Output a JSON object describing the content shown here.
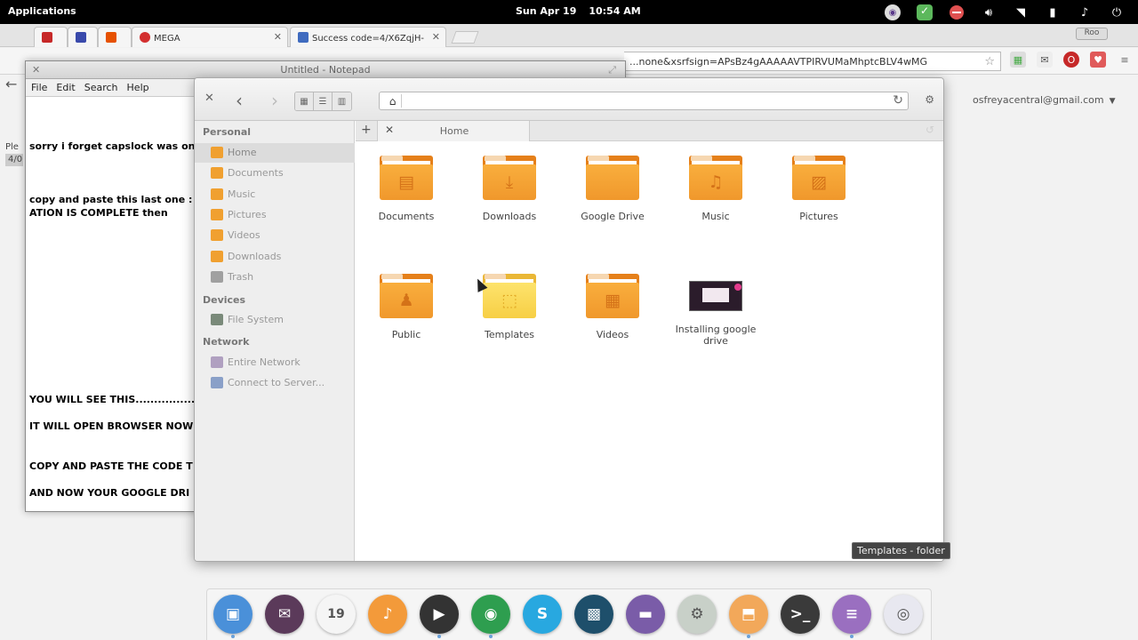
{
  "panel": {
    "applications_label": "Applications",
    "date": "Sun Apr 19",
    "time": "10:54 AM",
    "tray_icons": [
      "screenshot-icon",
      "checkmark-icon",
      "no-entry-icon",
      "volume-icon",
      "wifi-icon",
      "battery-icon",
      "bell-icon",
      "power-icon"
    ]
  },
  "browser": {
    "tabs": [
      {
        "label": "",
        "icon": "gmail-icon",
        "color": "#c62828"
      },
      {
        "label": "",
        "icon": "z-icon",
        "color": "#3949ab"
      },
      {
        "label": "",
        "icon": "tool-icon",
        "color": "#e65100"
      },
      {
        "label": "MEGA",
        "icon": "mega-icon",
        "color": "#d32f2f"
      },
      {
        "label": "Success code=4/X6ZqjH-",
        "icon": "google-icon",
        "color": "#3f6bbf"
      }
    ],
    "url_text": "...none&xsrfsign=APsBz4gAAAAAVTPIRVUMaMhptcBLV4wMG",
    "account": "osfreyacentral@gmail.com",
    "left_stub": [
      "Ple",
      "4/0"
    ],
    "window_button": "Roo"
  },
  "notepad": {
    "title": "Untitled - Notepad",
    "menu": [
      "File",
      "Edit",
      "Search",
      "Help"
    ],
    "lines": [
      "sorry i forget capslock was on",
      "copy and paste this last one : i",
      "ATION IS COMPLETE then",
      "YOU WILL SEE THIS................",
      "IT WILL OPEN BROWSER NOW",
      "COPY AND PASTE THE CODE T",
      "AND NOW YOUR GOOGLE DRI"
    ]
  },
  "files": {
    "tab_label": "Home",
    "sidebar": {
      "personal_heading": "Personal",
      "personal": [
        {
          "label": "Home",
          "icon": "home-icon",
          "color": "#f0a030"
        },
        {
          "label": "Documents",
          "icon": "documents-icon",
          "color": "#f0a030"
        },
        {
          "label": "Music",
          "icon": "music-icon",
          "color": "#f0a030"
        },
        {
          "label": "Pictures",
          "icon": "pictures-icon",
          "color": "#f0a030"
        },
        {
          "label": "Videos",
          "icon": "videos-icon",
          "color": "#f0a030"
        },
        {
          "label": "Downloads",
          "icon": "downloads-icon",
          "color": "#f0a030"
        },
        {
          "label": "Trash",
          "icon": "trash-icon",
          "color": "#a0a0a0"
        }
      ],
      "devices_heading": "Devices",
      "devices": [
        {
          "label": "File System",
          "icon": "drive-icon",
          "color": "#7a8a7a"
        }
      ],
      "network_heading": "Network",
      "network": [
        {
          "label": "Entire Network",
          "icon": "network-icon",
          "color": "#b0a0c0"
        },
        {
          "label": "Connect to Server...",
          "icon": "server-icon",
          "color": "#8aa0c8"
        }
      ]
    },
    "items": [
      {
        "label": "Documents",
        "glyph": "▤"
      },
      {
        "label": "Downloads",
        "glyph": "⤓"
      },
      {
        "label": "Google Drive",
        "glyph": ""
      },
      {
        "label": "Music",
        "glyph": "♫"
      },
      {
        "label": "Pictures",
        "glyph": "▨"
      },
      {
        "label": "Public",
        "glyph": "♟"
      },
      {
        "label": "Templates",
        "glyph": "⬚"
      },
      {
        "label": "Videos",
        "glyph": "▦"
      },
      {
        "label": "Installing google drive",
        "glyph": ""
      }
    ],
    "tooltip": "Templates - folder"
  },
  "dock": [
    {
      "name": "multitasking-view-icon",
      "color": "#4a90d9",
      "glyph": "▣"
    },
    {
      "name": "mail-icon",
      "color": "#5b3a5a",
      "glyph": "✉"
    },
    {
      "name": "calendar-icon",
      "color": "#f5f5f5",
      "glyph": "19"
    },
    {
      "name": "music-player-icon",
      "color": "#f39a3a",
      "glyph": "♪"
    },
    {
      "name": "video-player-icon",
      "color": "#333333",
      "glyph": "▶"
    },
    {
      "name": "chrome-icon",
      "color": "#2e9e4f",
      "glyph": "◉"
    },
    {
      "name": "skype-icon",
      "color": "#28a8e0",
      "glyph": "S"
    },
    {
      "name": "photos-icon",
      "color": "#1e4f6b",
      "glyph": "▩"
    },
    {
      "name": "notes-icon",
      "color": "#7a5ca8",
      "glyph": "▬"
    },
    {
      "name": "switchboard-icon",
      "color": "#c8d0c8",
      "glyph": "⚙"
    },
    {
      "name": "store-icon",
      "color": "#f2a85a",
      "glyph": "⬒"
    },
    {
      "name": "terminal-icon",
      "color": "#3a3a3a",
      "glyph": ">_"
    },
    {
      "name": "text-editor-icon",
      "color": "#9a6fc0",
      "glyph": "≡"
    },
    {
      "name": "camera-icon",
      "color": "#e8e8f0",
      "glyph": "◎"
    }
  ]
}
